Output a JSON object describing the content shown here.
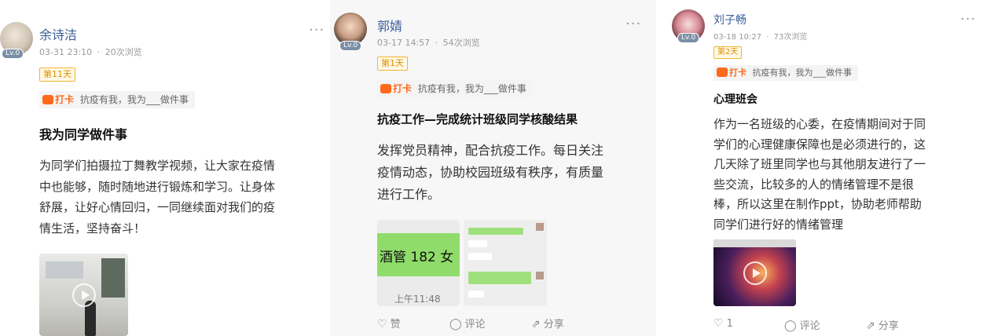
{
  "posts": [
    {
      "author": "余诗洁",
      "level": "Lv.0",
      "date": "03-31 23:10",
      "views": "20次浏览",
      "day_badge": "第11天",
      "topic_tag": "打卡",
      "topic_text": "抗疫有我，我为___做件事",
      "title": "我为同学做件事",
      "body_lines": [
        "为同学们拍摄拉丁舞教学视频，让大家在疫情",
        "中也能够，随时随地进行锻炼和学习。让身体",
        "舒展，让好心情回归，一同继续面对我们的疫",
        "情生活，坚持奋斗！"
      ]
    },
    {
      "author": "郭婧",
      "level": "Lv.0",
      "date": "03-17 14:57",
      "views": "54次浏览",
      "day_badge": "第1天",
      "topic_tag": "打卡",
      "topic_text": "抗疫有我，我为___做件事",
      "title": "抗疫工作—完成统计班级同学核酸结果",
      "body_lines": [
        "发挥党员精神，配合抗疫工作。每日关注",
        "疫情动态，协助校园班级有秩序，有质量",
        "进行工作。"
      ],
      "image_caption_big": "酒管 182 女",
      "image_time": "上午11:48",
      "like_label": "赞",
      "comment_label": "评论",
      "share_label": "分享"
    },
    {
      "author": "刘子畅",
      "level": "Lv.0",
      "date": "03-18 10:27",
      "views": "73次浏览",
      "day_badge": "第2天",
      "topic_tag": "打卡",
      "topic_text": "抗疫有我，我为___做件事",
      "title": "心理班会",
      "body_lines": [
        "作为一名班级的心委，在疫情期间对于同",
        "学们的心理健康保障也是必须进行的，这",
        "几天除了班里同学也与其他朋友进行了一",
        "些交流，比较多的人的情绪管理不是很",
        "棒，所以这里在制作ppt，协助老师帮助",
        "同学们进行好的情绪管理"
      ],
      "like_count": "1",
      "comment_label": "评论",
      "share_label": "分享"
    }
  ],
  "separator": "·",
  "more_symbol": "···",
  "icons": {
    "heart": "♡",
    "comment": "◯",
    "share": "⇗"
  },
  "colors": {
    "name": "#3b5f9a",
    "badge_text": "#e08f00",
    "topic_tag": "#ff6a1a",
    "chat_green": "#8fdc6a"
  }
}
